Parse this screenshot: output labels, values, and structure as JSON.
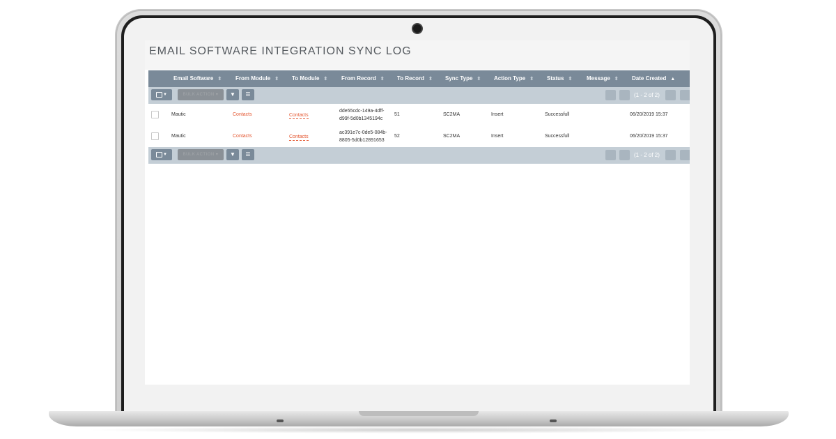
{
  "page": {
    "title": "EMAIL SOFTWARE INTEGRATION SYNC LOG"
  },
  "table": {
    "columns": [
      {
        "label": "Email Software",
        "sort": "sortable"
      },
      {
        "label": "From Module",
        "sort": "sortable"
      },
      {
        "label": "To Module",
        "sort": "sortable"
      },
      {
        "label": "From Record",
        "sort": "sortable"
      },
      {
        "label": "To Record",
        "sort": "sortable"
      },
      {
        "label": "Sync Type",
        "sort": "sortable"
      },
      {
        "label": "Action Type",
        "sort": "sortable"
      },
      {
        "label": "Status",
        "sort": "sortable"
      },
      {
        "label": "Message",
        "sort": "sortable"
      },
      {
        "label": "Date Created",
        "sort": "ascending"
      }
    ],
    "rows": [
      {
        "email_software": "Mautic",
        "from_module": "Contacts",
        "to_module": "Contacts",
        "from_record": "dde55cdc-149a-4dff-d99f-5d0b1345194c",
        "to_record": "51",
        "sync_type": "SC2MA",
        "action_type": "Insert",
        "status": "Successfull",
        "message": "",
        "date_created": "06/20/2019 15:37"
      },
      {
        "email_software": "Mautic",
        "from_module": "Contacts",
        "to_module": "Contacts",
        "from_record": "ac391e7c-0de5-084b-8805-5d0b12891653",
        "to_record": "52",
        "sync_type": "SC2MA",
        "action_type": "Insert",
        "status": "Successfull",
        "message": "",
        "date_created": "06/20/2019 15:37"
      }
    ]
  },
  "toolbar": {
    "bulk_action_label": "BULK ACTION ▾",
    "pagination_text": "(1 - 2 of 2)",
    "select_icon": "checkbox-dropdown-icon",
    "filter_icon": "filter-icon",
    "columns_icon": "list-icon"
  },
  "colors": {
    "header_bar": "#7a8a99",
    "toolbar_bar": "#c4ced6",
    "link": "#e4552e"
  }
}
